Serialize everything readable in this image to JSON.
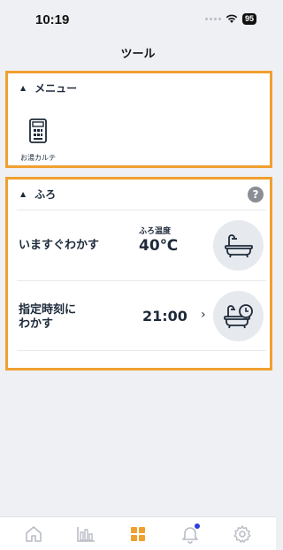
{
  "status_bar": {
    "time": "10:19",
    "battery": "95"
  },
  "page": {
    "title": "ツール"
  },
  "menu_section": {
    "title": "メニュー",
    "items": [
      {
        "label": "お湯カルテ",
        "icon": "bath-record-icon"
      }
    ]
  },
  "bath_section": {
    "title": "ふろ",
    "help": "?",
    "rows": [
      {
        "label": "いますぐわかす",
        "caption": "ふろ温度",
        "value": "40℃",
        "icon": "bathtub-icon"
      },
      {
        "label_line1": "指定時刻に",
        "label_line2": "わかす",
        "value": "21:00",
        "chevron": "›",
        "icon": "bathtub-clock-icon"
      }
    ]
  },
  "tab_bar": {
    "tabs": [
      {
        "icon": "home-icon",
        "active": false
      },
      {
        "icon": "bar-chart-icon",
        "active": false
      },
      {
        "icon": "grid-icon",
        "active": true
      },
      {
        "icon": "bell-icon",
        "active": false,
        "badge": true
      },
      {
        "icon": "gear-icon",
        "active": false
      }
    ],
    "colors": {
      "active": "#f0a030",
      "inactive": "#b8bcc4",
      "badge": "#2e3ddf"
    }
  },
  "colors": {
    "highlight_border": "#f0a030",
    "background": "#eef0f4"
  }
}
